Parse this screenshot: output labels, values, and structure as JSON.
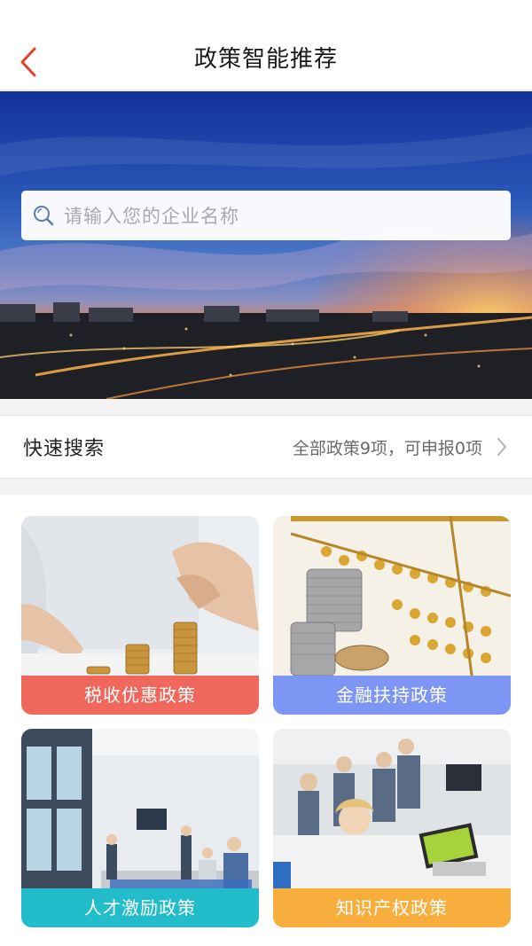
{
  "header": {
    "title": "政策智能推荐",
    "back_icon": "chevron-left-icon",
    "back_color": "#e5412f"
  },
  "search": {
    "placeholder": "请输入您的企业名称",
    "icon": "search-icon"
  },
  "quick_search": {
    "title": "快速搜索",
    "summary": "全部政策9项，可申报0项",
    "arrow_icon": "chevron-right-icon"
  },
  "categories": [
    {
      "label": "税收优惠政策",
      "color": "#f0675b"
    },
    {
      "label": "金融扶持政策",
      "color": "#7d96f3"
    },
    {
      "label": "人才激励政策",
      "color": "#22bccb"
    },
    {
      "label": "知识产权政策",
      "color": "#f7ae3c"
    }
  ]
}
